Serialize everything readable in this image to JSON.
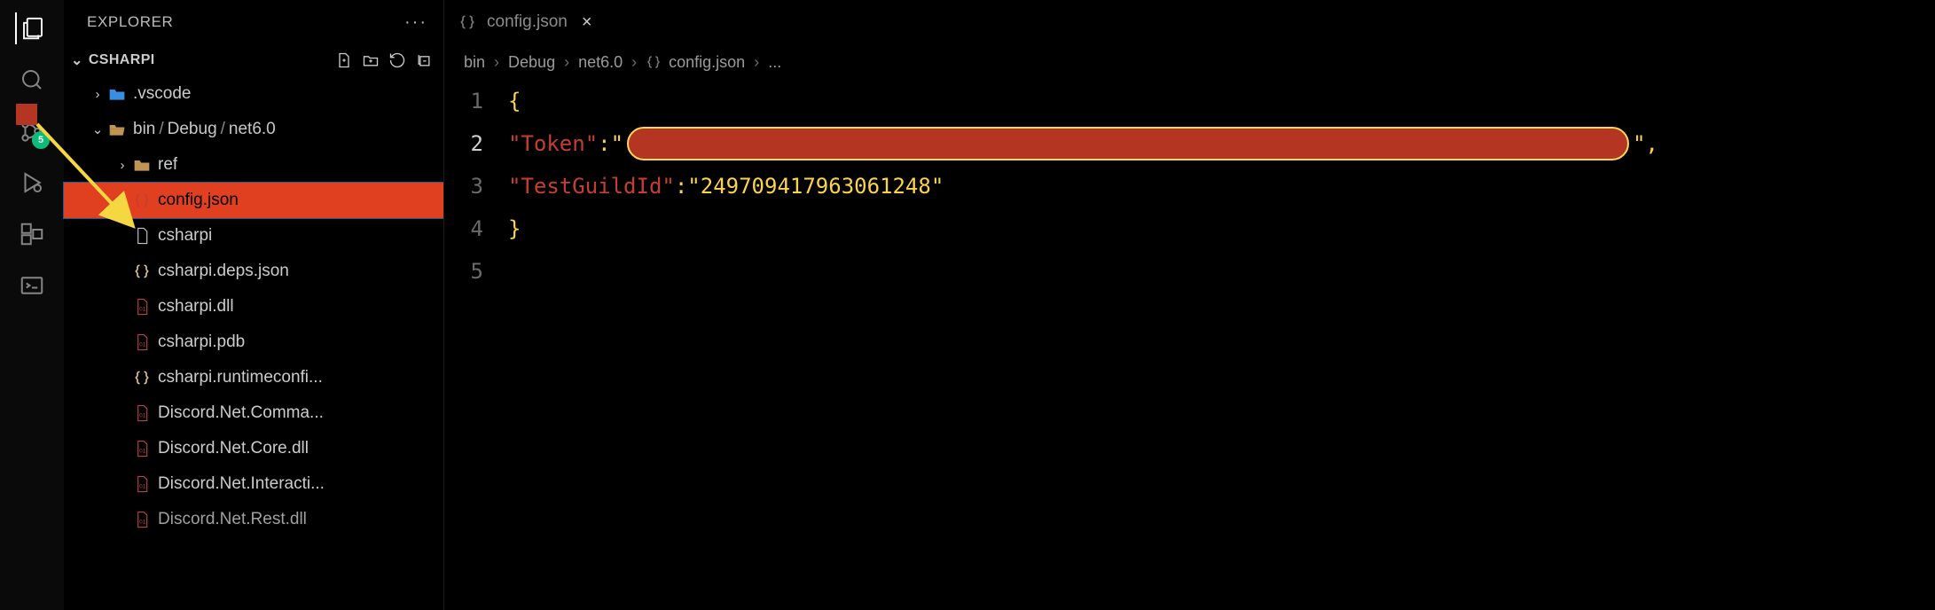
{
  "sidebar": {
    "title": "EXPLORER",
    "root_name": "CSHARPI",
    "badge_count": "5",
    "tree": {
      "vscode": ".vscode",
      "bin": "bin",
      "debug": "Debug",
      "net60": "net6.0",
      "ref": "ref",
      "config": "config.json",
      "csharpi": "csharpi",
      "deps": "csharpi.deps.json",
      "dll": "csharpi.dll",
      "pdb": "csharpi.pdb",
      "runtime": "csharpi.runtimeconfi...",
      "dnet_cmd": "Discord.Net.Comma...",
      "dnet_core": "Discord.Net.Core.dll",
      "dnet_inter": "Discord.Net.Interacti...",
      "dnet_rest": "Discord.Net.Rest.dll"
    }
  },
  "tab": {
    "label": "config.json"
  },
  "breadcrumbs": {
    "items": [
      "bin",
      "Debug",
      "net6.0",
      "config.json",
      "..."
    ]
  },
  "editor_content": {
    "lines": [
      "1",
      "2",
      "3",
      "4",
      "5"
    ],
    "key_token": "\"Token\"",
    "key_guild": "\"TestGuildId\"",
    "val_guild": "\"249709417963061248\""
  }
}
